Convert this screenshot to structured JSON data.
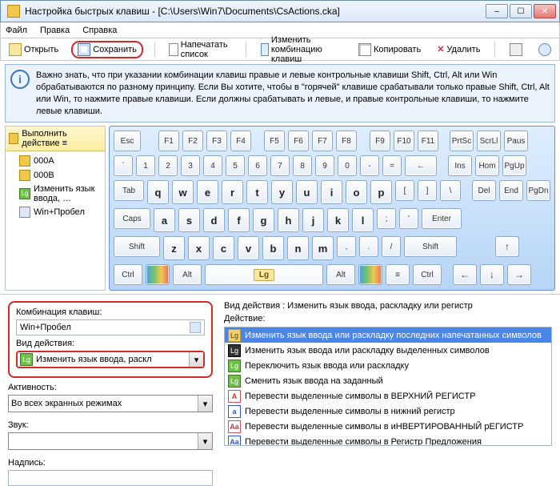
{
  "window": {
    "title": "Настройка быстрых клавиш - [C:\\Users\\Win7\\Documents\\CsActions.cka]"
  },
  "menu": {
    "file": "Файл",
    "edit": "Правка",
    "help": "Справка"
  },
  "toolbar": {
    "open": "Открыть",
    "save": "Сохранить",
    "print": "Напечатать список",
    "editcombo": "Изменить комбинацию клавиш",
    "copy": "Копировать",
    "delete": "Удалить"
  },
  "info": {
    "text": "Важно знать, что при указании комбинации клавиш правые и левые контрольные клавиши Shift, Ctrl, Alt или Win обрабатываются по разному принципу. Если Вы хотите, чтобы в \"горячей\" клавише срабатывали только правые Shift, Ctrl, Alt или Win, то нажмите правые клавиши. Если должны срабатывать и левые, и правые контрольные клавиши, то нажмите левые клавиши."
  },
  "tree": {
    "header": "Выполнить действие ≡",
    "i1": "000A",
    "i2": "000B",
    "i3": "Изменить язык ввода, …",
    "i4": "Win+Пробел"
  },
  "keys": {
    "esc": "Esc",
    "f1": "F1",
    "f2": "F2",
    "f3": "F3",
    "f4": "F4",
    "f5": "F5",
    "f6": "F6",
    "f7": "F7",
    "f8": "F8",
    "f9": "F9",
    "f10": "F10",
    "f11": "F11",
    "prtsc": "PrtSc",
    "scrll": "ScrLl",
    "pause": "Paus",
    "tilde": "`",
    "d1": "1",
    "d2": "2",
    "d3": "3",
    "d4": "4",
    "d5": "5",
    "d6": "6",
    "d7": "7",
    "d8": "8",
    "d9": "9",
    "d0": "0",
    "minus": "-",
    "eq": "=",
    "bs": "←",
    "ins": "Ins",
    "home": "Hom",
    "pgup": "PgUp",
    "tab": "Tab",
    "q": "q",
    "w": "w",
    "e": "e",
    "r": "r",
    "t": "t",
    "y": "y",
    "u": "u",
    "i": "i",
    "o": "o",
    "p": "p",
    "lb": "[",
    "rb": "]",
    "bsl": "\\",
    "del": "Del",
    "end": "End",
    "pgdn": "PgDn",
    "caps": "Caps",
    "a": "a",
    "s": "s",
    "d": "d",
    "f": "f",
    "g": "g",
    "h": "h",
    "j": "j",
    "k": "k",
    "l": "l",
    "sc": ";",
    "ap": "'",
    "enter": "Enter",
    "lshift": "Shift",
    "z": "z",
    "x": "x",
    "c": "c",
    "v": "v",
    "b": "b",
    "n": "n",
    "m": "m",
    "cm": ",",
    "pd": ".",
    "sl": "/",
    "rshift": "Shift",
    "up": "↑",
    "lctrl": "Ctrl",
    "lalt": "Alt",
    "lg": "Lg",
    "ralt": "Alt",
    "rctrl": "Ctrl",
    "left": "←",
    "down": "↓",
    "right": "→"
  },
  "bottom": {
    "combo_label": "Комбинация клавиш:",
    "combo_value": "Win+Пробел",
    "action_label": "Вид действия:",
    "action_combo": "Изменить язык ввода, раскл",
    "active_label": "Активность:",
    "active_value": "Во всех экранных режимах",
    "sound_label": "Звук:",
    "caption_label": "Надпись:",
    "right_header": "Вид действия : Изменить язык ввода, раскладку или регистр",
    "right_label": "Действие:",
    "actions": [
      "Изменить язык ввода или раскладку последних напечатанных символов",
      "Изменить язык ввода или раскладку выделенных символов",
      "Переключить язык ввода или раскладку",
      "Сменить язык ввода на заданный",
      "Перевести выделенные символы в ВЕРХНИЙ РЕГИСТР",
      "Перевести выделенные символы в нижний регистр",
      "Перевести выделенные символы в иНВЕРТИРОВАННЫЙ рЕГИСТР",
      "Перевести выделенные символы в Регистр Предложения"
    ]
  }
}
